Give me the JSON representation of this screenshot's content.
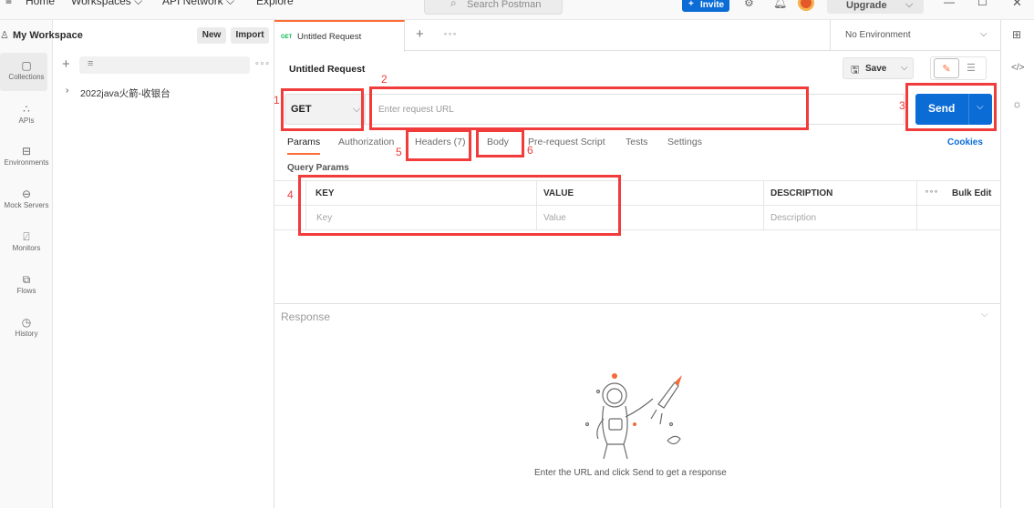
{
  "topbar": {
    "nav": [
      "Home",
      "Workspaces",
      "API Network",
      "Explore"
    ],
    "search_placeholder": "Search Postman",
    "invite_label": "Invite",
    "upgrade_label": "Upgrade"
  },
  "rail": {
    "items": [
      {
        "label": "Collections",
        "icon": "collections-icon"
      },
      {
        "label": "APIs",
        "icon": "apis-icon"
      },
      {
        "label": "Environments",
        "icon": "environments-icon"
      },
      {
        "label": "Mock Servers",
        "icon": "mock-servers-icon"
      },
      {
        "label": "Monitors",
        "icon": "monitors-icon"
      },
      {
        "label": "Flows",
        "icon": "flows-icon"
      },
      {
        "label": "History",
        "icon": "history-icon"
      }
    ]
  },
  "sidebar": {
    "workspace": "My Workspace",
    "new_label": "New",
    "import_label": "Import",
    "collection": "2022java火箭-收银台"
  },
  "tabs": {
    "active": {
      "method": "GET",
      "title": "Untitled Request"
    },
    "environment": "No Environment"
  },
  "request": {
    "title": "Untitled Request",
    "save_label": "Save",
    "method": "GET",
    "url_placeholder": "Enter request URL",
    "send_label": "Send",
    "subtabs": [
      "Params",
      "Authorization",
      "Headers (7)",
      "Body",
      "Pre-request Script",
      "Tests",
      "Settings"
    ],
    "cookies_label": "Cookies",
    "query_params_label": "Query Params",
    "table": {
      "headers": [
        "KEY",
        "VALUE",
        "DESCRIPTION"
      ],
      "placeholders": [
        "Key",
        "Value",
        "Description"
      ],
      "bulk_edit": "Bulk Edit"
    }
  },
  "response": {
    "title": "Response",
    "empty_message": "Enter the URL and click Send to get a response"
  },
  "annotations": [
    "1",
    "2",
    "3",
    "4",
    "5",
    "6"
  ],
  "colors": {
    "accent": "#ff6c37",
    "send": "#0b6cd6",
    "annotation": "#f23b3b"
  }
}
